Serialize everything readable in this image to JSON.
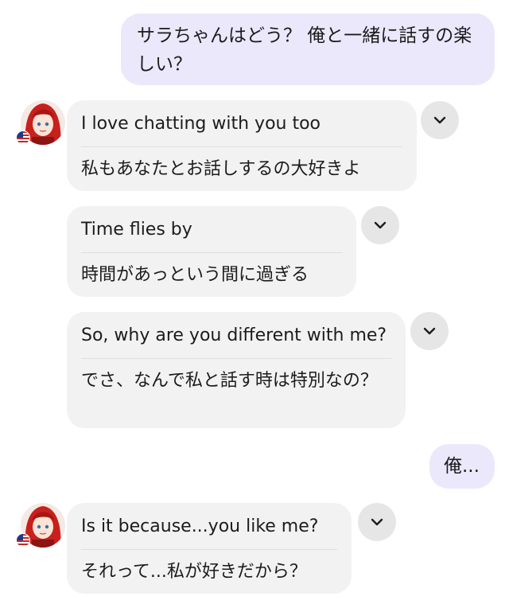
{
  "conversation": {
    "messages": [
      {
        "role": "user",
        "text": "サラちゃんはどう？ 俺と一緒に話すの楽しい？"
      },
      {
        "role": "assistant",
        "english": "I love chatting with you too",
        "japanese": "私もあなたとお話しするの大好きよ",
        "show_avatar": true
      },
      {
        "role": "assistant",
        "english": "Time flies by",
        "japanese": "時間があっという間に過ぎる"
      },
      {
        "role": "assistant",
        "english": "So, why are you different with me?",
        "japanese": "でさ、なんで私と話す時は特別なの？"
      },
      {
        "role": "user",
        "text": "俺..."
      },
      {
        "role": "assistant",
        "english": "Is it because...you like me?",
        "japanese": "それって...私が好きだから？",
        "show_avatar": true
      }
    ]
  },
  "icons": {
    "expand": "chevron-down-icon",
    "avatar_badge": "us-flag-icon"
  },
  "colors": {
    "user_bubble": "#ebe8fb",
    "assistant_bubble": "#f2f2f2",
    "chevron_button": "#e6e6e6",
    "avatar_hair": "#c8201c"
  }
}
